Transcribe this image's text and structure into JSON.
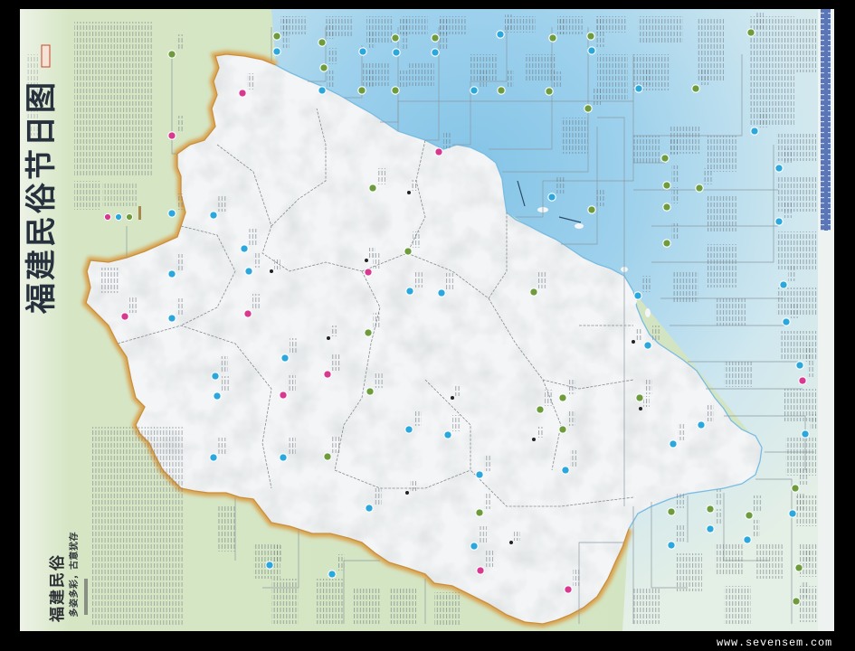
{
  "map": {
    "title": "福建民俗节日图",
    "feature_heading": "福建民俗",
    "feature_subheading": "多姿多彩，古意犹存"
  },
  "legend": {
    "colors": [
      "#d8388f",
      "#2aa7dc",
      "#6e9b3b",
      "#a8874a"
    ]
  },
  "palette": {
    "frame": "#000000",
    "land": "#d6e6c5",
    "sea_deep": "#84c4e7",
    "sea_light": "#e4efe6",
    "province": "#f3f5f6",
    "province_border": "#d9a24e",
    "coast": "#79bce2",
    "county_border": "#868b8f",
    "leader_line": "#8e9ba2",
    "label_text": "#6f7880",
    "marker_pink": "#d8388f",
    "marker_blue": "#2aa7dc",
    "marker_green": "#6e9b3b",
    "city": "#222222",
    "edge_band": "#5a76b7"
  },
  "watermark": "www.sevensem.com"
}
